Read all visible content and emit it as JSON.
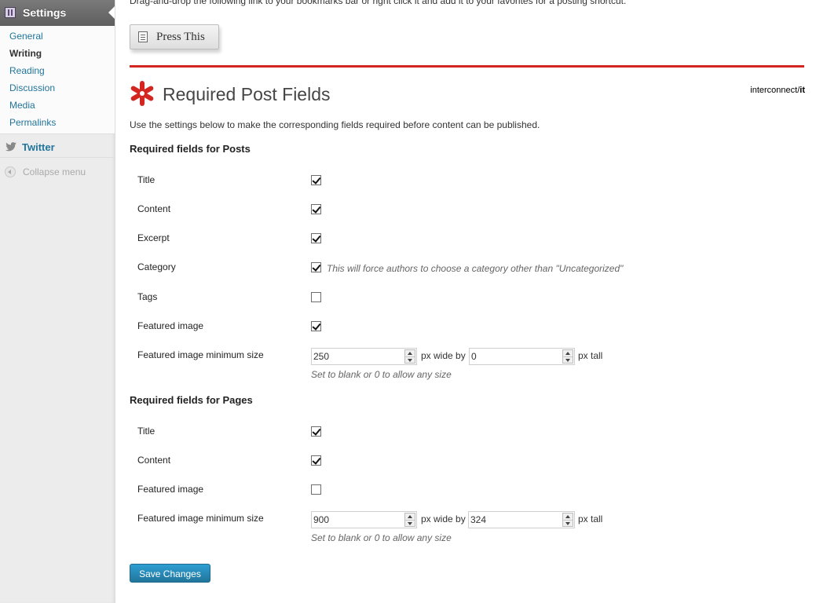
{
  "sidebar": {
    "header_label": "Settings",
    "items": [
      {
        "label": "General"
      },
      {
        "label": "Writing"
      },
      {
        "label": "Reading"
      },
      {
        "label": "Discussion"
      },
      {
        "label": "Media"
      },
      {
        "label": "Permalinks"
      }
    ],
    "current": "Writing",
    "twitter_label": "Twitter",
    "collapse_label": "Collapse menu"
  },
  "top_note": "Drag-and-drop the following link to your bookmarks bar or right click it and add it to your favorites for a posting shortcut.",
  "press_this_label": "Press This",
  "plugin": {
    "title": "Required Post Fields",
    "brand_prefix": "interconnect/",
    "brand_suffix": "it",
    "intro": "Use the settings below to make the corresponding fields required before content can be published.",
    "accent_color": "#d42621"
  },
  "posts": {
    "heading": "Required fields for Posts",
    "fields": [
      {
        "label": "Title",
        "checked": true
      },
      {
        "label": "Content",
        "checked": true
      },
      {
        "label": "Excerpt",
        "checked": true
      },
      {
        "label": "Category",
        "checked": true,
        "hint": "This will force authors to choose a category other than \"Uncategorized\""
      },
      {
        "label": "Tags",
        "checked": false
      },
      {
        "label": "Featured image",
        "checked": true
      }
    ],
    "min_size": {
      "label": "Featured image minimum size",
      "width": "250",
      "height": "0",
      "wide_text": "px wide by",
      "tall_text": "px tall",
      "hint": "Set to blank or 0 to allow any size"
    }
  },
  "pages": {
    "heading": "Required fields for Pages",
    "fields": [
      {
        "label": "Title",
        "checked": true
      },
      {
        "label": "Content",
        "checked": true
      },
      {
        "label": "Featured image",
        "checked": false
      }
    ],
    "min_size": {
      "label": "Featured image minimum size",
      "width": "900",
      "height": "324",
      "wide_text": "px wide by",
      "tall_text": "px tall",
      "hint": "Set to blank or 0 to allow any size"
    }
  },
  "save_label": "Save Changes",
  "colors": {
    "link": "#21759b",
    "button": "#21759b"
  }
}
